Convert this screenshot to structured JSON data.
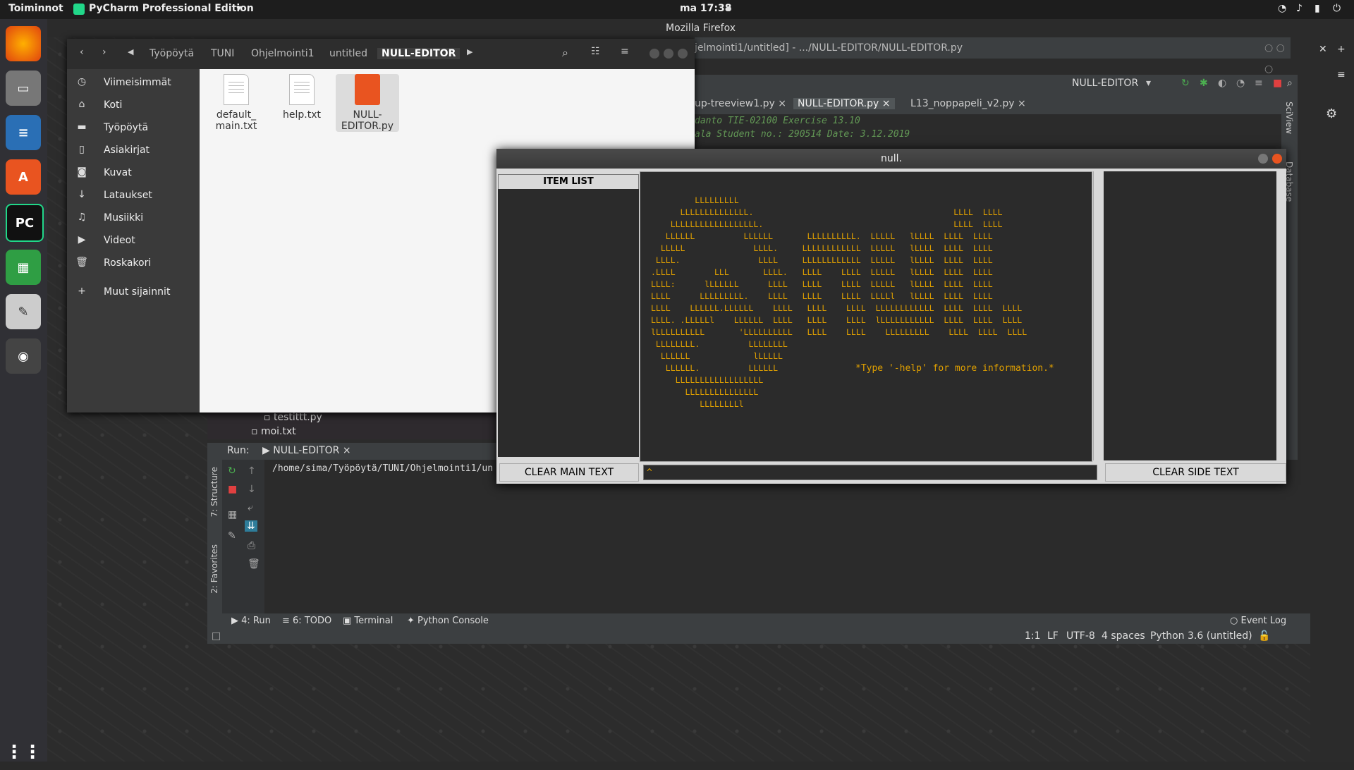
{
  "topbar": {
    "activities": "Toiminnot",
    "app_menu": "PyCharm Professional Edition",
    "clock": "ma 17:38"
  },
  "firefox": {
    "title": "Mozilla Firefox"
  },
  "pycharm": {
    "title_fragment": "jelmointi1/untitled] - .../NULL-EDITOR/NULL-EDITOR.py",
    "run_config": "NULL-EDITOR",
    "tabs": [
      "up-treeview1.py",
      "NULL-EDITOR.py",
      "L13_noppapeli_v2.py"
    ],
    "editor_lines": [
      "danto TIE-02100 Exercise 13.10",
      "ala Student no.: 290514 Date: 3.12.2019"
    ],
    "tree_items": [
      "testittt.py",
      "moi.txt"
    ],
    "run_label": "Run:",
    "run_tab": "NULL-EDITOR",
    "run_output": "/home/sima/Työpöytä/TUNI/Ohjelmointi1/un",
    "side_labels": [
      "7: Structure",
      "2: Favorites"
    ],
    "bottom_tabs": [
      "4: Run",
      "6: TODO",
      "Terminal",
      "Python Console"
    ],
    "event_log": "Event Log",
    "status": [
      "1:1",
      "LF",
      "UTF-8",
      "4 spaces",
      "Python 3.6 (untitled)"
    ],
    "right_tools": [
      "SciView",
      "Database"
    ]
  },
  "files": {
    "breadcrumbs": [
      "Työpöytä",
      "TUNI",
      "Ohjelmointi1",
      "untitled",
      "NULL-EDITOR"
    ],
    "sidebar": [
      {
        "label": "Viimeisimmät",
        "icon": "clock-icon"
      },
      {
        "label": "Koti",
        "icon": "home-icon"
      },
      {
        "label": "Työpöytä",
        "icon": "folder-icon"
      },
      {
        "label": "Asiakirjat",
        "icon": "document-icon"
      },
      {
        "label": "Kuvat",
        "icon": "camera-icon"
      },
      {
        "label": "Lataukset",
        "icon": "download-icon"
      },
      {
        "label": "Musiikki",
        "icon": "music-icon"
      },
      {
        "label": "Videot",
        "icon": "video-icon"
      },
      {
        "label": "Roskakori",
        "icon": "trash-icon"
      },
      {
        "label": "Muut sijainnit",
        "icon": "plus-icon"
      }
    ],
    "items": [
      {
        "name1": "default_",
        "name2": "main.txt"
      },
      {
        "name1": "help.txt",
        "name2": ""
      },
      {
        "name1": "NULL-",
        "name2": "EDITOR.py"
      }
    ]
  },
  "nulleditor": {
    "title": "null.",
    "item_list_header": "ITEM LIST",
    "ascii_art": "         LLLLLLLLL\n      LLLLLLLLLLLLLL.                                         LLLL  LLLL\n    LLLLLLLLLLLLLLLLLL.                                       LLLL  LLLL\n   LLLLLL          LLLLLL       LLLLLLLLLL.  LLLLL   lLLLL  LLLL  LLLL\n  LLLLL              LLLL.     LLLLLLLLLLLL  LLLLL   lLLLL  LLLL  LLLL\n LLLL.                LLLL     LLLLLLLLLLLL  LLLLL   lLLLL  LLLL  LLLL\n.LLLL        LLL       LLLL.   LLLL    LLLL  LLLLL   lLLLL  LLLL  LLLL\nLLLL:      lLLLLLL      LLLL   LLLL    LLLL  LLLLL   lLLLL  LLLL  LLLL\nLLLL      LLLLLLLLL.    LLLL   LLLL    LLLL  LLLLl   lLLLL  LLLL  LLLL\nLLLL    LLLLLL.LLLLLL    LLLL   LLLL    LLLL  LLLLLLLLLLLL  LLLL  LLLL  LLLL\nLLLL. .LLLLLl    LLLLLL  LLLL   LLLL    LLLL  lLLLLLLLLLLL  LLLL  LLLL  LLLL\nlLLLLLLLLLL       'LLLLLLLLLL   LLLL    LLLL    LLLLLLLLL    LLLL  LLLL  LLLL\n LLLLLLLL.          LLLLLLLL\n  LLLLLL             lLLLLL\n   LLLLLL.          LLLLLL\n     LLLLLLLLLLLLLLLLLL\n       LLLLLLLLLLLLLLL\n          LLLLLLLLl",
    "help_hint": "*Type '-help' for more information.*",
    "clear_main": "CLEAR MAIN TEXT",
    "clear_side": "CLEAR SIDE TEXT",
    "command_value": "^"
  }
}
